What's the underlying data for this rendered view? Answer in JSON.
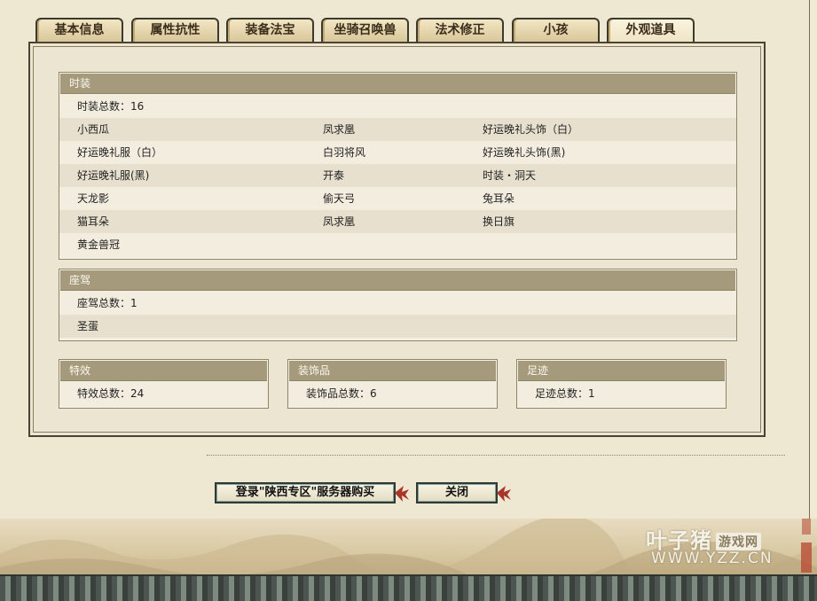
{
  "tabs": [
    "基本信息",
    "属性抗性",
    "装备法宝",
    "坐骑召唤兽",
    "法术修正",
    "小孩",
    "外观道具"
  ],
  "active_tab": "外观道具",
  "fashion": {
    "title": "时装",
    "count_label": "时装总数：16",
    "items": [
      [
        "小西瓜",
        "凤求凰",
        "好运晚礼头饰（白）"
      ],
      [
        "好运晚礼服（白）",
        "白羽将风",
        "好运晚礼头饰(黑)"
      ],
      [
        "好运晚礼服(黑)",
        "开泰",
        "时装・洞天"
      ],
      [
        "天龙影",
        "偷天弓",
        "兔耳朵"
      ],
      [
        "猫耳朵",
        "凤求凰",
        "换日旗"
      ],
      [
        "黄金兽冠",
        "",
        ""
      ]
    ]
  },
  "mount": {
    "title": "座驾",
    "count_label": "座驾总数：1",
    "items": [
      "圣蛋"
    ]
  },
  "effects": {
    "title": "特效",
    "count_label": "特效总数：24"
  },
  "ornaments": {
    "title": "装饰品",
    "count_label": "装饰品总数：6"
  },
  "footprints": {
    "title": "足迹",
    "count_label": "足迹总数：1"
  },
  "buttons": {
    "buy": "登录\"陕西专区\"服务器购买",
    "close": "关闭"
  },
  "watermark": {
    "brand": "叶子猪",
    "tag": "游戏网",
    "site": "WWW.YZZ.CN"
  }
}
